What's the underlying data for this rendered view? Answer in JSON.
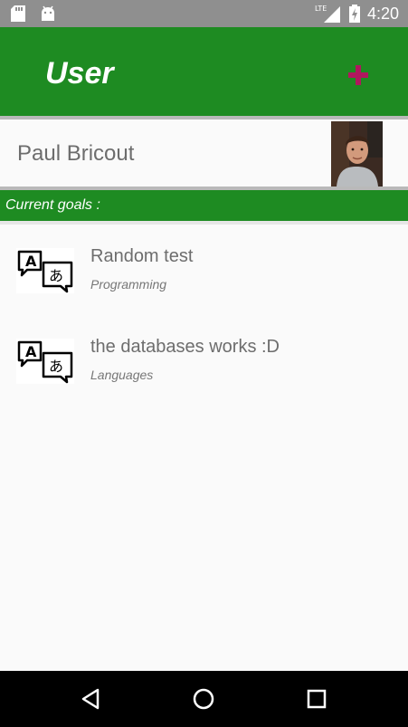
{
  "status_bar": {
    "left_icons": [
      "sd-card-icon",
      "android-icon"
    ],
    "network_label": "LTE",
    "time": "4:20"
  },
  "app_bar": {
    "title": "User",
    "add_icon": "plus-icon",
    "add_color": "#b0175e",
    "background": "#1e8b22"
  },
  "profile": {
    "name": "Paul Bricout",
    "avatar": "avatar-photo"
  },
  "goals_section": {
    "title": "Current goals :",
    "items": [
      {
        "title": "Random test",
        "category": "Programming",
        "icon": "translate-icon"
      },
      {
        "title": "the databases works :D",
        "category": "Languages",
        "icon": "translate-icon"
      }
    ]
  },
  "nav_bar": {
    "buttons": [
      "back-icon",
      "home-icon",
      "recents-icon"
    ]
  }
}
